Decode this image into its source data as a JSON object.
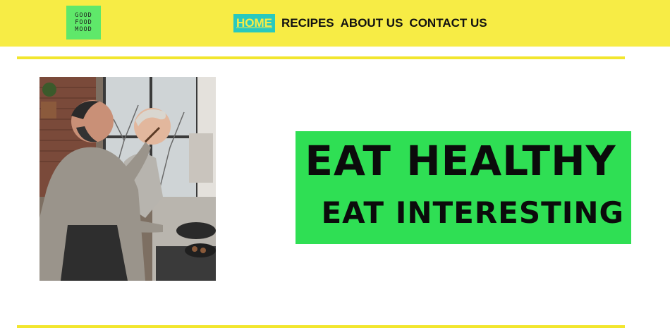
{
  "logo": {
    "lines": [
      "GOOD",
      "FOOD",
      "MOOD"
    ]
  },
  "nav": {
    "items": [
      {
        "label": "HOME",
        "active": true
      },
      {
        "label": "RECIPES",
        "active": false
      },
      {
        "label": "ABOUT US",
        "active": false
      },
      {
        "label": "CONTACT US",
        "active": false
      }
    ]
  },
  "hero": {
    "line1": "EAT HEALTHY",
    "line2": "EAT INTERESTING"
  },
  "colors": {
    "header_bg": "#f7ec45",
    "logo_bg": "#5fe86a",
    "nav_active_bg": "#29c9bd",
    "hero_bg": "#2fdf54",
    "rule": "#f2e62e"
  },
  "image": {
    "subject": "couple-cooking-in-kitchen-photo"
  }
}
